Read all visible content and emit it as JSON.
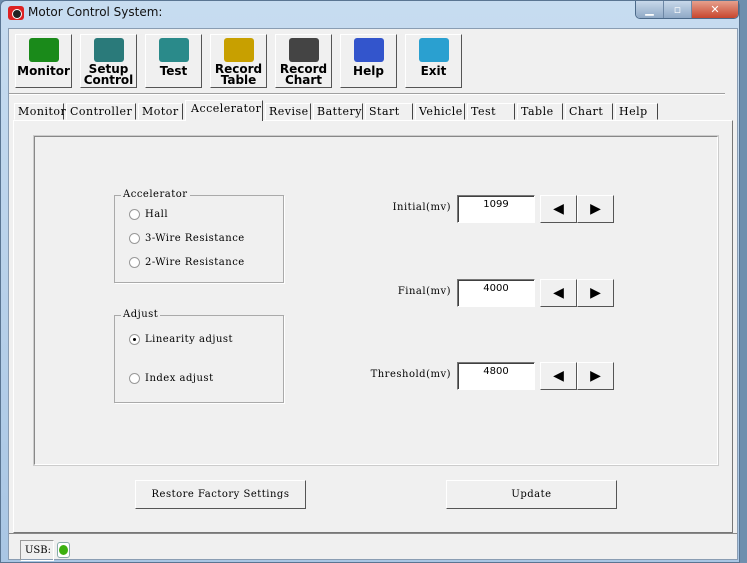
{
  "window": {
    "title": "Motor Control System:"
  },
  "toolbar": [
    {
      "label1": "Monitor",
      "label2": "",
      "icon": "monitor-grid-icon",
      "color": "#1a8a1a"
    },
    {
      "label1": "Setup",
      "label2": "Control",
      "icon": "setup-clock-icon",
      "color": "#2a7a7a"
    },
    {
      "label1": "Test",
      "label2": "",
      "icon": "question-icon",
      "color": "#2a8a8a"
    },
    {
      "label1": "Record",
      "label2": "Table",
      "icon": "record-table-icon",
      "color": "#c8a000"
    },
    {
      "label1": "Record",
      "label2": "Chart",
      "icon": "record-chart-icon",
      "color": "#444444"
    },
    {
      "label1": "Help",
      "label2": "",
      "icon": "help-document-icon",
      "color": "#3355cc"
    },
    {
      "label1": "Exit",
      "label2": "",
      "icon": "exit-door-icon",
      "color": "#2aa0d0"
    }
  ],
  "tabs": [
    "Monitor",
    "Controller",
    "Motor",
    "Accelerator",
    "Revise",
    "Battery",
    "Start",
    "Vehicle",
    "Test",
    "Table",
    "Chart",
    "Help"
  ],
  "active_tab": "Accelerator",
  "accelerator_group": {
    "title": "Accelerator",
    "options": [
      "Hall",
      "3-Wire Resistance",
      "2-Wire Resistance"
    ]
  },
  "adjust_group": {
    "title": "Adjust",
    "options": [
      "Linearity adjust",
      "Index adjust"
    ],
    "selected": "Linearity adjust"
  },
  "fields": [
    {
      "label": "Initial(mv)",
      "value": "1099"
    },
    {
      "label": "Final(mv)",
      "value": "4000"
    },
    {
      "label": "Threshold(mv)",
      "value": "4800"
    }
  ],
  "buttons": {
    "restore": "Restore Factory Settings",
    "update": "Update"
  },
  "status": {
    "usb_label": "USB:",
    "usb_color": "#3bb010"
  }
}
